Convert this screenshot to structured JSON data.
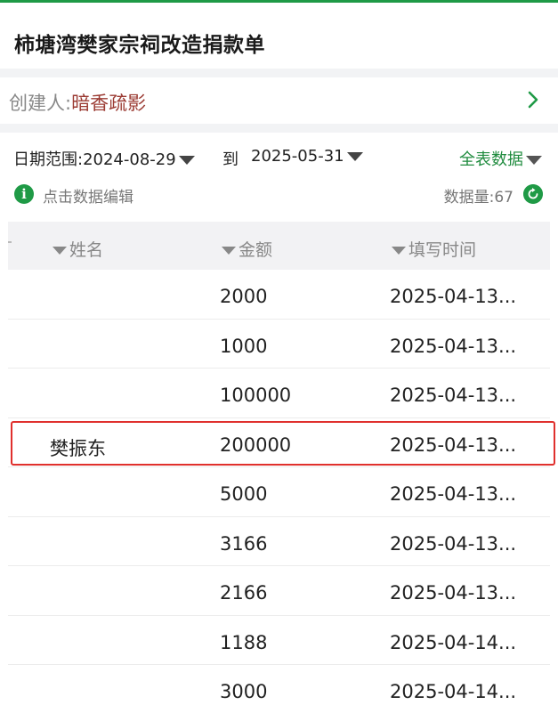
{
  "app": {
    "title": "柿塘湾樊家宗祠改造捐款单"
  },
  "creator": {
    "label": "创建人:",
    "name": "暗香疏影"
  },
  "filters": {
    "date_range_label": "日期范围:2024-08-29",
    "to_label": "到",
    "date_end": "2025-05-31",
    "all_data_label": "全表数据"
  },
  "info": {
    "edit_hint": "点击数据编辑",
    "count_label": "数据量:67"
  },
  "table": {
    "headers": {
      "name": "姓名",
      "amount": "金额",
      "time": "填写时间"
    },
    "rows": [
      {
        "name": "",
        "amount": "2000",
        "time": "2025-04-13..."
      },
      {
        "name": "",
        "amount": "1000",
        "time": "2025-04-13..."
      },
      {
        "name": "",
        "amount": "100000",
        "time": "2025-04-13..."
      },
      {
        "name": "樊振东",
        "amount": "200000",
        "time": "2025-04-13..."
      },
      {
        "name": "",
        "amount": "5000",
        "time": "2025-04-13..."
      },
      {
        "name": "",
        "amount": "3166",
        "time": "2025-04-13..."
      },
      {
        "name": "",
        "amount": "2166",
        "time": "2025-04-13..."
      },
      {
        "name": "",
        "amount": "1188",
        "time": "2025-04-14..."
      },
      {
        "name": "",
        "amount": "3000",
        "time": "2025-04-14..."
      }
    ]
  },
  "colors": {
    "accent_green": "#1f9a46",
    "highlight_red": "#e0302d",
    "creator_name": "#9b3b33"
  }
}
